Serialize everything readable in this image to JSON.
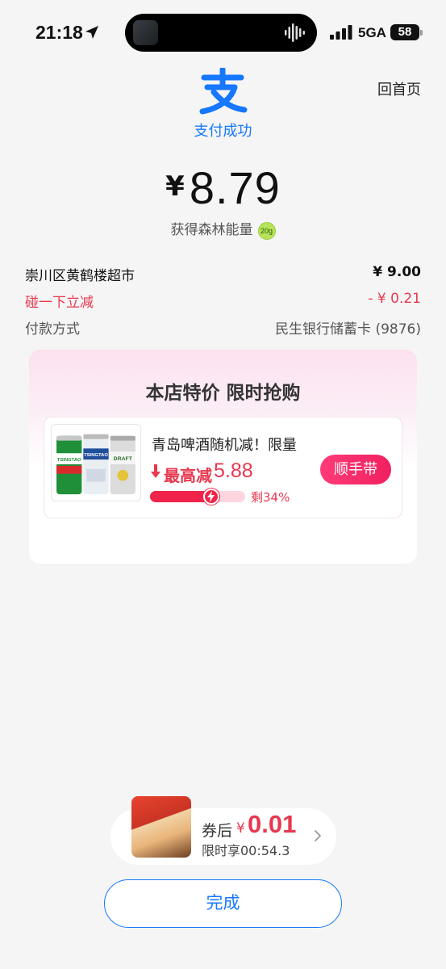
{
  "status_bar": {
    "time": "21:18",
    "network": "5GA",
    "battery": "58"
  },
  "header": {
    "app_logo_char": "支",
    "home_link": "回首页",
    "status_text": "支付成功"
  },
  "payment": {
    "currency_symbol": "¥",
    "amount": "8.79",
    "energy_text": "获得森林能量",
    "energy_badge": "20g"
  },
  "details": {
    "merchant": "崇川区黄鹤楼超市",
    "merchant_amount": "¥ 9.00",
    "discount_label": "碰一下立减",
    "discount_amount": "- ¥ 0.21",
    "payment_method_label": "付款方式",
    "payment_method_value": "民生银行储蓄卡 (9876)"
  },
  "promo": {
    "title": "本店特价 限时抢购",
    "product_name": "青岛啤酒随机减！限量",
    "max_reduce_label": "最高减",
    "max_reduce_value": "5.88",
    "remaining_text": "剩34%",
    "remaining_fraction": 0.66,
    "buy_button": "顺手带",
    "can_brands": [
      "TSINGTAO",
      "TSINGTAO",
      "DRAFT"
    ]
  },
  "deal": {
    "after_coupon_label": "券后",
    "currency": "¥",
    "price": "0.01",
    "timer_text": "限时享00:54.3"
  },
  "done_button": "完成",
  "colors": {
    "accent_blue": "#1677ff",
    "accent_red": "#e8384f",
    "button_pink": "#f0205f"
  }
}
